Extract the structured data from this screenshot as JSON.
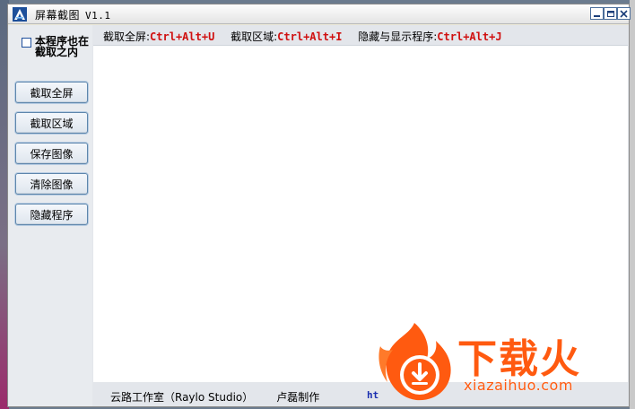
{
  "window": {
    "title": "屏幕截图",
    "version": "V1.1"
  },
  "sidebar": {
    "include_self_label": "本程序也在截取之内",
    "buttons": [
      {
        "label": "截取全屏"
      },
      {
        "label": "截取区域"
      },
      {
        "label": "保存图像"
      },
      {
        "label": "清除图像"
      },
      {
        "label": "隐藏程序"
      }
    ]
  },
  "hotkeys": [
    {
      "label": "截取全屏:",
      "key": "Ctrl+Alt+U"
    },
    {
      "label": "截取区域:",
      "key": "Ctrl+Alt+I"
    },
    {
      "label": "隐藏与显示程序:",
      "key": "Ctrl+Alt+J"
    }
  ],
  "footer": {
    "studio": "云路工作室（Raylo Studio）",
    "author": "卢磊制作",
    "link_partial": "ht"
  },
  "watermark": {
    "brand": "下载火",
    "domain": "xiazaihuo.com"
  },
  "colors": {
    "hotkey_red": "#d01010",
    "watermark_orange": "#ff5a10",
    "link_blue": "#1a2fb0"
  }
}
